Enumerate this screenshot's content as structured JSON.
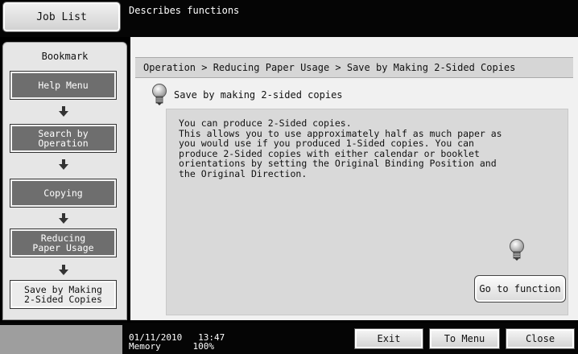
{
  "header": {
    "job_list_label": "Job List",
    "message": "Describes functions"
  },
  "sidebar": {
    "title": "Bookmark",
    "items": [
      {
        "label": "Help Menu"
      },
      {
        "label": "Search by\nOperation"
      },
      {
        "label": "Copying"
      },
      {
        "label": "Reducing\nPaper Usage"
      },
      {
        "label": "Save by Making\n2-Sided Copies"
      }
    ]
  },
  "main": {
    "breadcrumb": "Operation > Reducing Paper Usage > Save by Making 2-Sided Copies",
    "heading": "Save by making 2-sided copies",
    "body": "You can produce 2-Sided copies.\nThis allows you to use approximately half as much paper as\nyou would use if you produced 1-Sided copies. You can\nproduce 2-Sided copies with either calendar or booklet\norientations by setting the Original Binding Position and\nthe Original Direction.",
    "go_button": "Go to function"
  },
  "footer": {
    "date": "01/11/2010",
    "time": "13:47",
    "memory_label": "Memory",
    "memory_value": "100%",
    "exit": "Exit",
    "to_menu": "To Menu",
    "close": "Close"
  },
  "icons": {
    "lightbulb": "lightbulb-icon",
    "arrow": "arrow-down-icon"
  }
}
